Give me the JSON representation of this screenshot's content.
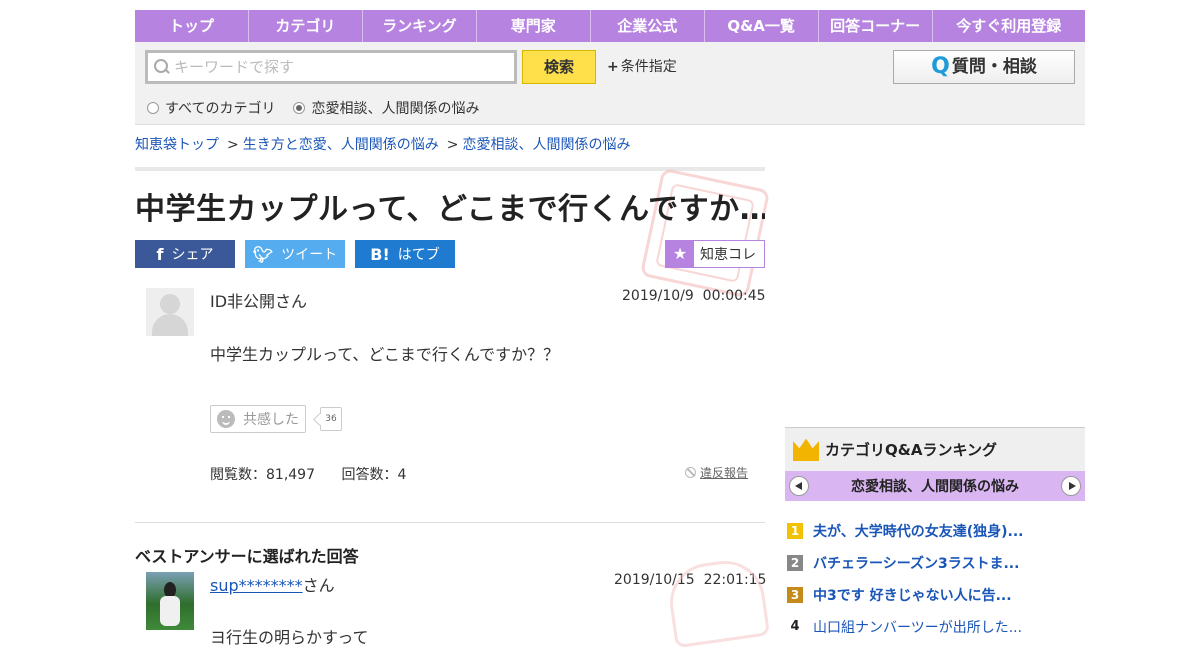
{
  "nav": {
    "items": [
      "トップ",
      "カテゴリ",
      "ランキング",
      "専門家",
      "企業公式",
      "Q&A一覧",
      "回答コーナー",
      "今すぐ利用登録"
    ]
  },
  "search": {
    "placeholder": "キーワードで探す",
    "button_label": "検索",
    "conditions_label": "条件指定",
    "ask_button_label": "質問・相談",
    "radio_all": "すべてのカテゴリ",
    "radio_category": "恋愛相談、人間関係の悩み"
  },
  "breadcrumb": {
    "items": [
      "知恵袋トップ",
      "生き方と恋愛、人間関係の悩み",
      "恋愛相談、人間関係の悩み"
    ],
    "separator": ">"
  },
  "question": {
    "title": "中学生カップルって、どこまで行くんですか…",
    "share": {
      "facebook": "シェア",
      "twitter": "ツイート",
      "hatena": "はてブ",
      "collection": "知恵コレ"
    },
    "user": "ID非公開さん",
    "date": "2019/10/9  00:00:45",
    "body": "中学生カップルって、どこまで行くんですか？？",
    "empathy_label": "共感した",
    "empathy_count": "36",
    "views_label": "閲覧数：81,497",
    "answers_label": "回答数：4",
    "report_label": "違反報告"
  },
  "best_answer": {
    "heading": "ベストアンサーに選ばれた回答",
    "user_link": "sup********",
    "user_suffix": "さん",
    "date": "2019/10/15  22:01:15",
    "body": "ヨ行生の明らかすって"
  },
  "ranking": {
    "heading": "カテゴリQ&Aランキング",
    "category": "恋愛相談、人間関係の悩み",
    "items": [
      {
        "rank": "1",
        "title": "夫が、大学時代の女友達(独身)..."
      },
      {
        "rank": "2",
        "title": "バチェラーシーズン3ラストま..."
      },
      {
        "rank": "3",
        "title": "中3です 好きじゃない人に告..."
      },
      {
        "rank": "4",
        "title": "山口組ナンバーツーが出所した..."
      }
    ]
  },
  "colors": {
    "nav_purple": "#b683e0",
    "search_yellow": "#ffe04a",
    "link_blue": "#1a56b8",
    "facebook": "#3b5998",
    "twitter": "#55acee",
    "hatena": "#1e7bd0"
  }
}
